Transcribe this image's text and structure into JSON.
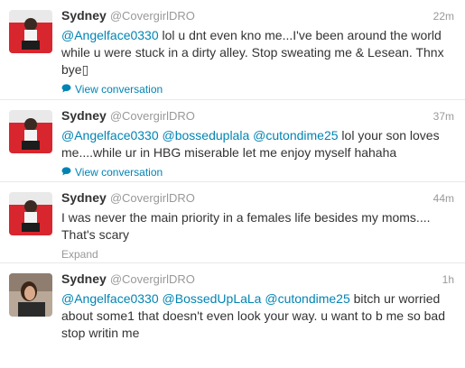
{
  "tweets": [
    {
      "fullname": "Sydney",
      "username": "@CovergirlDRO",
      "time": "22m",
      "mention": "@Angelface0330",
      "text": " lol u dnt even kno me...I've been around the world while u were stuck in a dirty alley. Stop sweating me & Lesean. Thnx bye▯",
      "action": "View conversation"
    },
    {
      "fullname": "Sydney",
      "username": "@CovergirlDRO",
      "time": "37m",
      "mentions": [
        "@Angelface0330",
        "@bosseduplala",
        "@cutondime25"
      ],
      "text": " lol your son loves me....while ur in HBG miserable let me enjoy myself hahaha",
      "action": "View conversation"
    },
    {
      "fullname": "Sydney",
      "username": "@CovergirlDRO",
      "time": "44m",
      "text": "I was never the main priority in a females life besides my moms.... That's scary",
      "action": "Expand"
    },
    {
      "fullname": "Sydney",
      "username": "@CovergirlDRO",
      "time": "1h",
      "mentions": [
        "@Angelface0330",
        "@BossedUpLaLa",
        "@cutondime25"
      ],
      "text": " bitch ur worried about some1 that doesn't even look your way. u want to b me so bad stop writin me"
    }
  ],
  "colors": {
    "link": "#0084b4",
    "meta": "#999999",
    "text": "#333333",
    "avatar_red": "#d8262e"
  },
  "icons": {
    "conversation": "speech-bubble-icon"
  }
}
